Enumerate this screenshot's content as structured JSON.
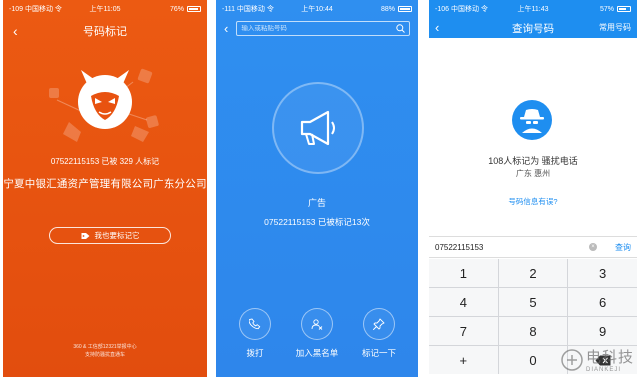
{
  "phone1": {
    "status": {
      "carrier": "-109 中国移动 令",
      "time": "上午11:05",
      "battery": "76%"
    },
    "title": "号码标记",
    "number_line": "07522115153 已被 329 人标记",
    "company": "宁夏中银汇通资产管理有限公司广东分公司",
    "mark_button": "我也要标记它",
    "footer_line1": "360 & 工信部12321举报中心",
    "footer_line2": "支持防骚扰直通车"
  },
  "phone2": {
    "status": {
      "carrier": "-111 中国移动 令",
      "time": "上午10:44",
      "battery": "88%"
    },
    "search_placeholder": "输入或粘贴号码",
    "category": "广告",
    "number_line": "07522115153  已被标记13次",
    "actions": [
      {
        "label": "拨打",
        "icon": "phone-icon"
      },
      {
        "label": "加入黑名单",
        "icon": "block-user-icon"
      },
      {
        "label": "标记一下",
        "icon": "pin-icon"
      }
    ]
  },
  "phone3": {
    "status": {
      "carrier": "-106 中国移动 令",
      "time": "上午11:43",
      "battery": "57%"
    },
    "title": "查询号码",
    "common_numbers": "常用号码",
    "tag_line": "108人标记为 骚扰电话",
    "location": "广东 惠州",
    "wrong_info": "号码信息有误?",
    "query_value": "07522115153",
    "query_button": "查询",
    "keys": [
      "1",
      "2",
      "3",
      "4",
      "5",
      "6",
      "7",
      "8",
      "9",
      "+",
      "0",
      ""
    ]
  },
  "watermark": {
    "cn": "电科技",
    "en": "DIANKEJI"
  },
  "colors": {
    "orange": "#e85210",
    "blue": "#2f8ff0",
    "link_blue": "#1e8ef0"
  }
}
